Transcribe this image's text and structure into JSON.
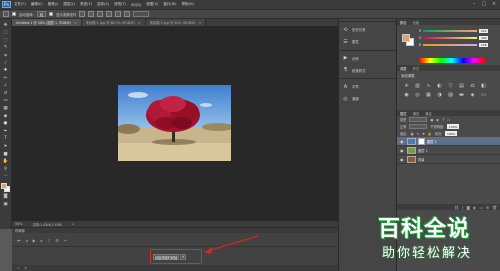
{
  "app": {
    "logo": "Ps"
  },
  "menu": [
    "文件(F)",
    "编辑(E)",
    "图像(I)",
    "图层(L)",
    "类型(Y)",
    "选择(S)",
    "滤镜(T)",
    "3D(D)",
    "视图(V)",
    "窗口(W)",
    "帮助(H)"
  ],
  "options_bar": {
    "auto_select_label": "自动选择:",
    "layer_dropdown": "组",
    "transform_label": "显示变换控件"
  },
  "tabs": [
    {
      "label": "Untitled-1 @ 50% (图层 1, RGB/8)",
      "active": true
    },
    {
      "label": "未标题-1.jpg @ 66.7% (RGB/8)",
      "active": false
    },
    {
      "label": "未标题-2.jpg @ 50% (RGB/8)",
      "active": false
    }
  ],
  "status_bar": {
    "zoom": "50%",
    "doc": "文档:1.45M/1.45M"
  },
  "timeline": {
    "title": "时间轴",
    "create_button": "创建视频时间轴"
  },
  "mini_panels": [
    {
      "icon": "history-icon",
      "label": "历史记录"
    },
    {
      "icon": "properties-icon",
      "label": "属性"
    },
    {
      "icon": "actions-icon",
      "label": "动作"
    },
    {
      "icon": "paragraph-icon",
      "label": "段落样式"
    },
    {
      "icon": "character-icon",
      "label": "字符"
    },
    {
      "icon": "swatches-icon",
      "label": "通道"
    }
  ],
  "color_panel": {
    "tabs": [
      "颜色",
      "色板"
    ],
    "channels": [
      {
        "label": "R",
        "value": "220"
      },
      {
        "label": "G",
        "value": "162"
      },
      {
        "label": "B",
        "value": "108"
      }
    ],
    "fg": "#dca26c",
    "bg": "#ffffff"
  },
  "adjust_panel": {
    "tabs": [
      "调整",
      "样式"
    ],
    "title": "添加调整"
  },
  "layers_panel": {
    "tabs": [
      "图层",
      "通道",
      "路径"
    ],
    "kind_label": "类型",
    "blend_mode": "正常",
    "opacity_label": "不透明度:",
    "opacity": "100%",
    "lock_label": "锁定:",
    "fill_label": "填充:",
    "fill": "100%",
    "layers": [
      {
        "name": "图层 2",
        "selected": true,
        "thumb_color": "#4a78b8"
      },
      {
        "name": "图层 1",
        "selected": false,
        "thumb_color": "#7a9a4a"
      },
      {
        "name": "背景",
        "selected": false,
        "thumb_color": "#8a5a3a"
      }
    ]
  },
  "watermark": {
    "title": "百科全说",
    "subtitle": "助你轻松解决"
  }
}
